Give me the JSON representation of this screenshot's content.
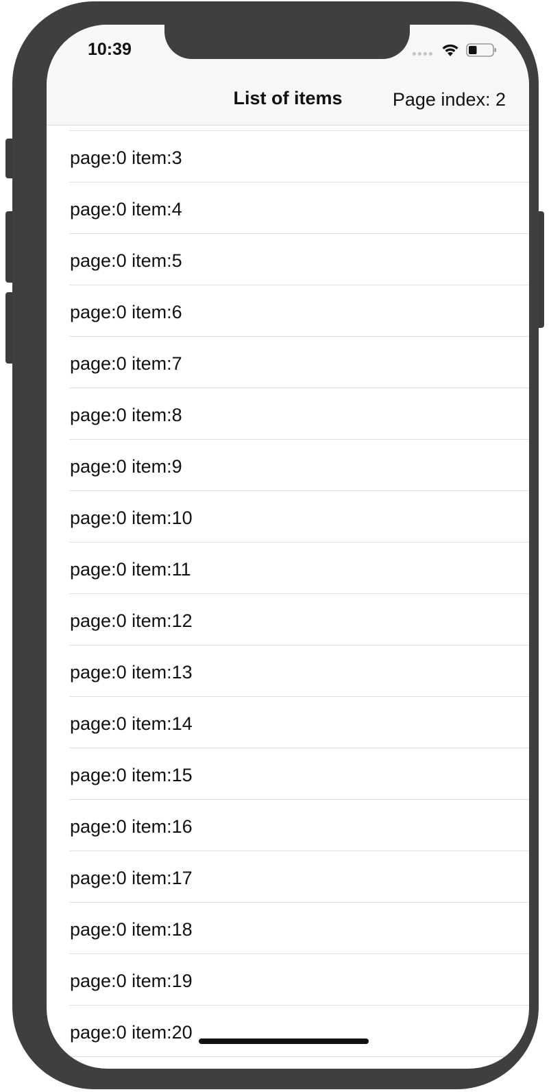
{
  "status_bar": {
    "time": "10:39",
    "wifi_icon": "wifi-icon",
    "battery_icon": "battery-icon",
    "battery_level": 0.35
  },
  "nav": {
    "title": "List of items",
    "right_text": "Page index: 2"
  },
  "list": {
    "items": [
      "page:0 item:3",
      "page:0 item:4",
      "page:0 item:5",
      "page:0 item:6",
      "page:0 item:7",
      "page:0 item:8",
      "page:0 item:9",
      "page:0 item:10",
      "page:0 item:11",
      "page:0 item:12",
      "page:0 item:13",
      "page:0 item:14",
      "page:0 item:15",
      "page:0 item:16",
      "page:0 item:17",
      "page:0 item:18",
      "page:0 item:19",
      "page:0 item:20"
    ]
  },
  "colors": {
    "frame": "#3f3f3f",
    "nav_background": "#f7f7f7",
    "separator": "#e0e0e0",
    "text": "#111111"
  }
}
